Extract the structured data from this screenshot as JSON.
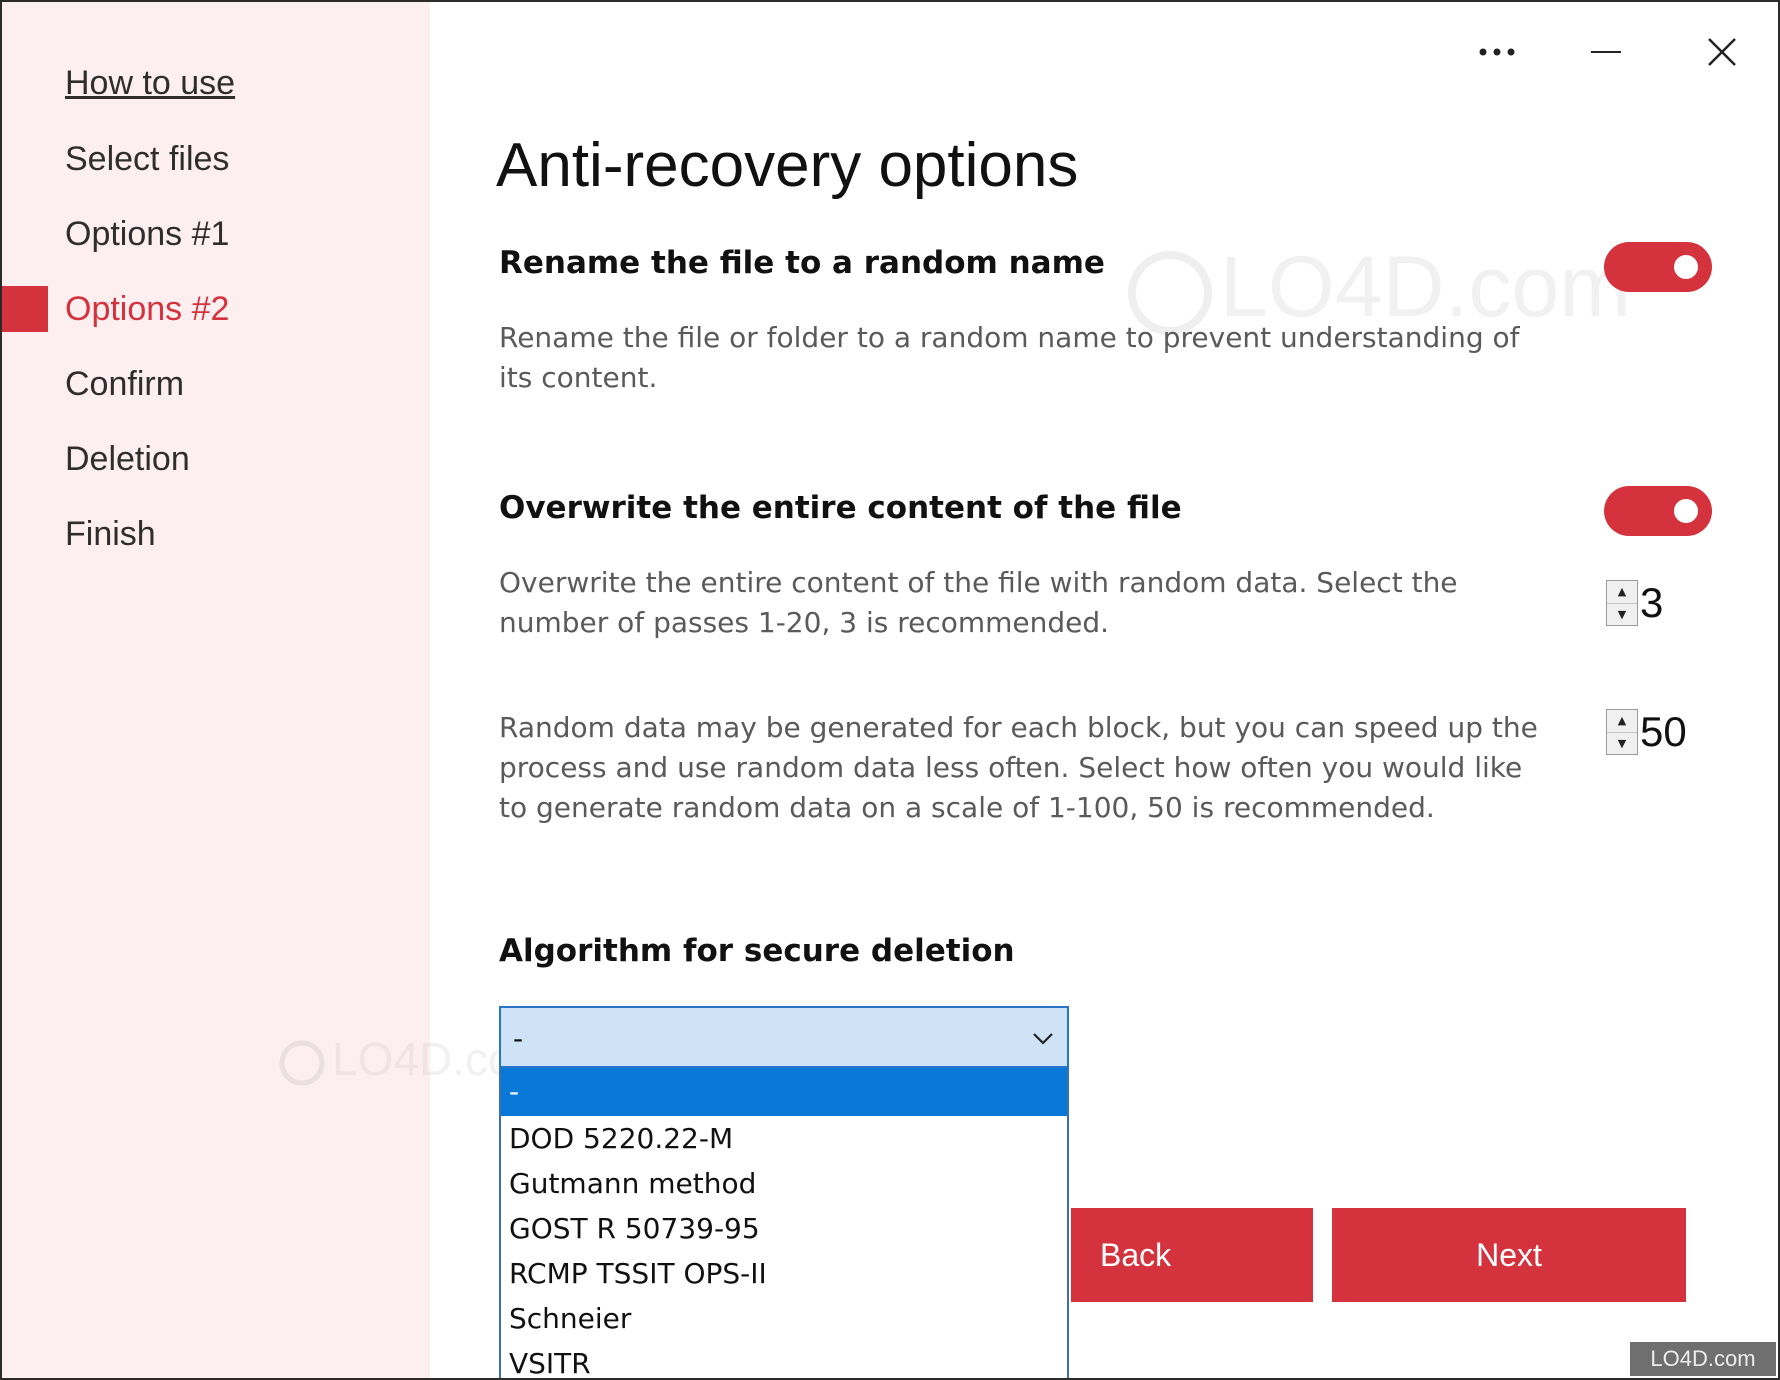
{
  "sidebar": {
    "items": [
      {
        "label": "How to use"
      },
      {
        "label": "Select files"
      },
      {
        "label": "Options #1"
      },
      {
        "label": "Options #2"
      },
      {
        "label": "Confirm"
      },
      {
        "label": "Deletion"
      },
      {
        "label": "Finish"
      }
    ],
    "active_index": 3
  },
  "titlebar": {
    "more_icon": "ellipsis-icon",
    "minimize_icon": "minimize-icon",
    "close_icon": "close-icon"
  },
  "main": {
    "title": "Anti-recovery options",
    "rename": {
      "title": "Rename the file to a random name",
      "description": "Rename the file or folder to a random name to prevent understanding of its content.",
      "enabled": true
    },
    "overwrite": {
      "title": "Overwrite the entire content of the file",
      "description": "Overwrite the entire content of the file with random data. Select the number of passes 1-20, 3 is recommended.",
      "enabled": true,
      "passes": "3"
    },
    "random_data": {
      "description": "Random data may be generated for each block, but you can speed up the process and use random data less often. Select how often you would like to generate random data on a scale of 1-100, 50 is recommended.",
      "frequency": "50"
    },
    "algorithm": {
      "title": "Algorithm for secure deletion",
      "selected": "-",
      "options": [
        "-",
        "DOD 5220.22-M",
        "Gutmann method",
        "GOST R 50739-95",
        "RCMP TSSIT OPS-II",
        "Schneier",
        "VSITR"
      ]
    },
    "buttons": {
      "back": "Back",
      "next": "Next"
    }
  },
  "watermark": {
    "large": "LO4D.com",
    "small": "LO4D.com",
    "badge": "LO4D.com"
  },
  "colors": {
    "accent": "#d4333d",
    "sidebar_bg": "#fdeef0",
    "selection": "#0a78d7",
    "combo_bg": "#cfe3f6"
  }
}
